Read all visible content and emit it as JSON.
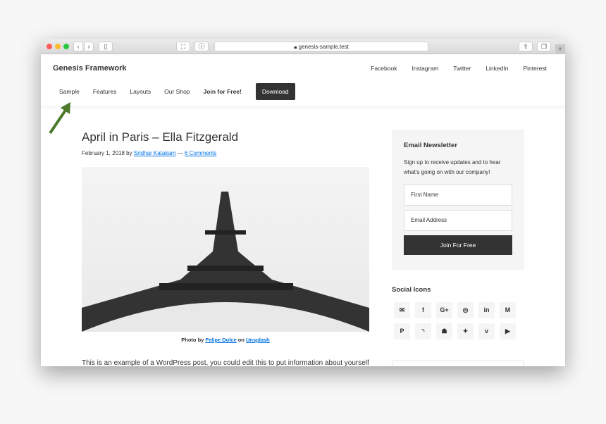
{
  "browser": {
    "url": "genesis-sample.test",
    "plus": "+"
  },
  "site": {
    "title": "Genesis Framework"
  },
  "social_nav": [
    "Facebook",
    "Instagram",
    "Twitter",
    "LinkedIn",
    "Pinterest"
  ],
  "nav": {
    "items": [
      "Sample",
      "Features",
      "Layouts",
      "Our Shop"
    ],
    "join": "Join for Free!",
    "download": "Download"
  },
  "post": {
    "title": "April in Paris – Ella Fitzgerald",
    "date": "February 1, 2018",
    "by": "by",
    "author": "Sridhar Katakam",
    "sep": "—",
    "comments": "6 Comments",
    "caption": {
      "prefix": "Photo by",
      "photographer": "Felipe Dolce",
      "on": "on",
      "source": "Unsplash"
    },
    "body": "This is an example of a WordPress post, you could edit this to put information about yourself"
  },
  "newsletter": {
    "title": "Email Newsletter",
    "text": "Sign up to receive updates and to hear what's going on with our company!",
    "first_name_placeholder": "First Name",
    "email_placeholder": "Email Address",
    "button": "Join For Free"
  },
  "social_icons": {
    "title": "Social Icons",
    "icons": [
      {
        "name": "email",
        "glyph": "✉"
      },
      {
        "name": "facebook",
        "glyph": "f"
      },
      {
        "name": "google-plus",
        "glyph": "G+"
      },
      {
        "name": "instagram",
        "glyph": "◎"
      },
      {
        "name": "linkedin",
        "glyph": "in"
      },
      {
        "name": "medium",
        "glyph": "M"
      },
      {
        "name": "pinterest",
        "glyph": "P"
      },
      {
        "name": "rss",
        "glyph": "◝"
      },
      {
        "name": "snapchat",
        "glyph": "☗"
      },
      {
        "name": "twitter",
        "glyph": "✦"
      },
      {
        "name": "vimeo",
        "glyph": "v"
      },
      {
        "name": "youtube",
        "glyph": "▶"
      }
    ]
  },
  "colors": {
    "accent": "#0073e5",
    "dark": "#333333",
    "arrow": "#4a7a2a"
  }
}
